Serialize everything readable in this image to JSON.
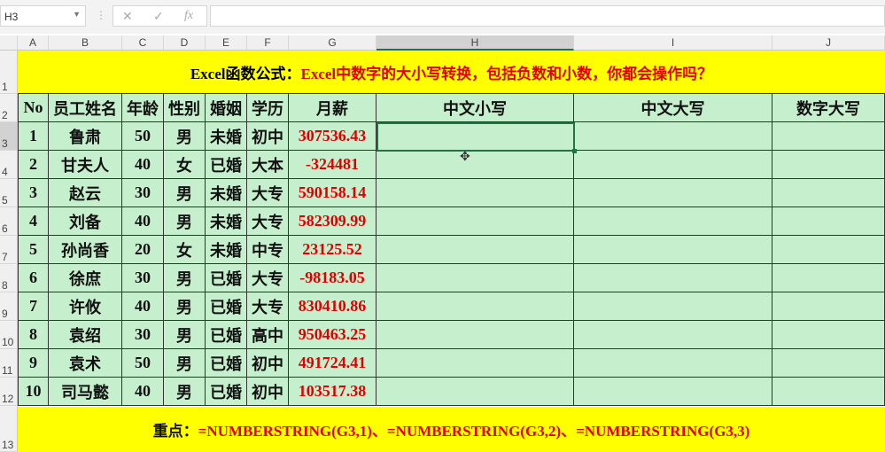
{
  "formula_bar": {
    "name_box": "H3",
    "cancel": "✕",
    "enter": "✓",
    "fx": "fx",
    "value": ""
  },
  "columns": [
    "A",
    "B",
    "C",
    "D",
    "E",
    "F",
    "G",
    "H",
    "I",
    "J"
  ],
  "rows": [
    "1",
    "2",
    "3",
    "4",
    "5",
    "6",
    "7",
    "8",
    "9",
    "10",
    "11",
    "12",
    "13"
  ],
  "title": {
    "black": "Excel函数公式：",
    "red": "Excel中数字的大小写转换，包括负数和小数，你都会操作吗？"
  },
  "headers": [
    "No",
    "员工姓名",
    "年龄",
    "性别",
    "婚姻",
    "学历",
    "月薪",
    "中文小写",
    "中文大写",
    "数字大写"
  ],
  "data": [
    [
      "1",
      "鲁肃",
      "50",
      "男",
      "未婚",
      "初中",
      "307536.43"
    ],
    [
      "2",
      "甘夫人",
      "40",
      "女",
      "已婚",
      "大本",
      "-324481"
    ],
    [
      "3",
      "赵云",
      "30",
      "男",
      "未婚",
      "大专",
      "590158.14"
    ],
    [
      "4",
      "刘备",
      "40",
      "男",
      "未婚",
      "大专",
      "582309.99"
    ],
    [
      "5",
      "孙尚香",
      "20",
      "女",
      "未婚",
      "中专",
      "23125.52"
    ],
    [
      "6",
      "徐庶",
      "30",
      "男",
      "已婚",
      "大专",
      "-98183.05"
    ],
    [
      "7",
      "许攸",
      "40",
      "男",
      "已婚",
      "大专",
      "830410.86"
    ],
    [
      "8",
      "袁绍",
      "30",
      "男",
      "已婚",
      "高中",
      "950463.25"
    ],
    [
      "9",
      "袁术",
      "50",
      "男",
      "已婚",
      "初中",
      "491724.41"
    ],
    [
      "10",
      "司马懿",
      "40",
      "男",
      "已婚",
      "初中",
      "103517.38"
    ]
  ],
  "footer": {
    "black": "重点：",
    "red": "=NUMBERSTRING(G3,1)、=NUMBERSTRING(G3,2)、=NUMBERSTRING(G3,3)"
  }
}
